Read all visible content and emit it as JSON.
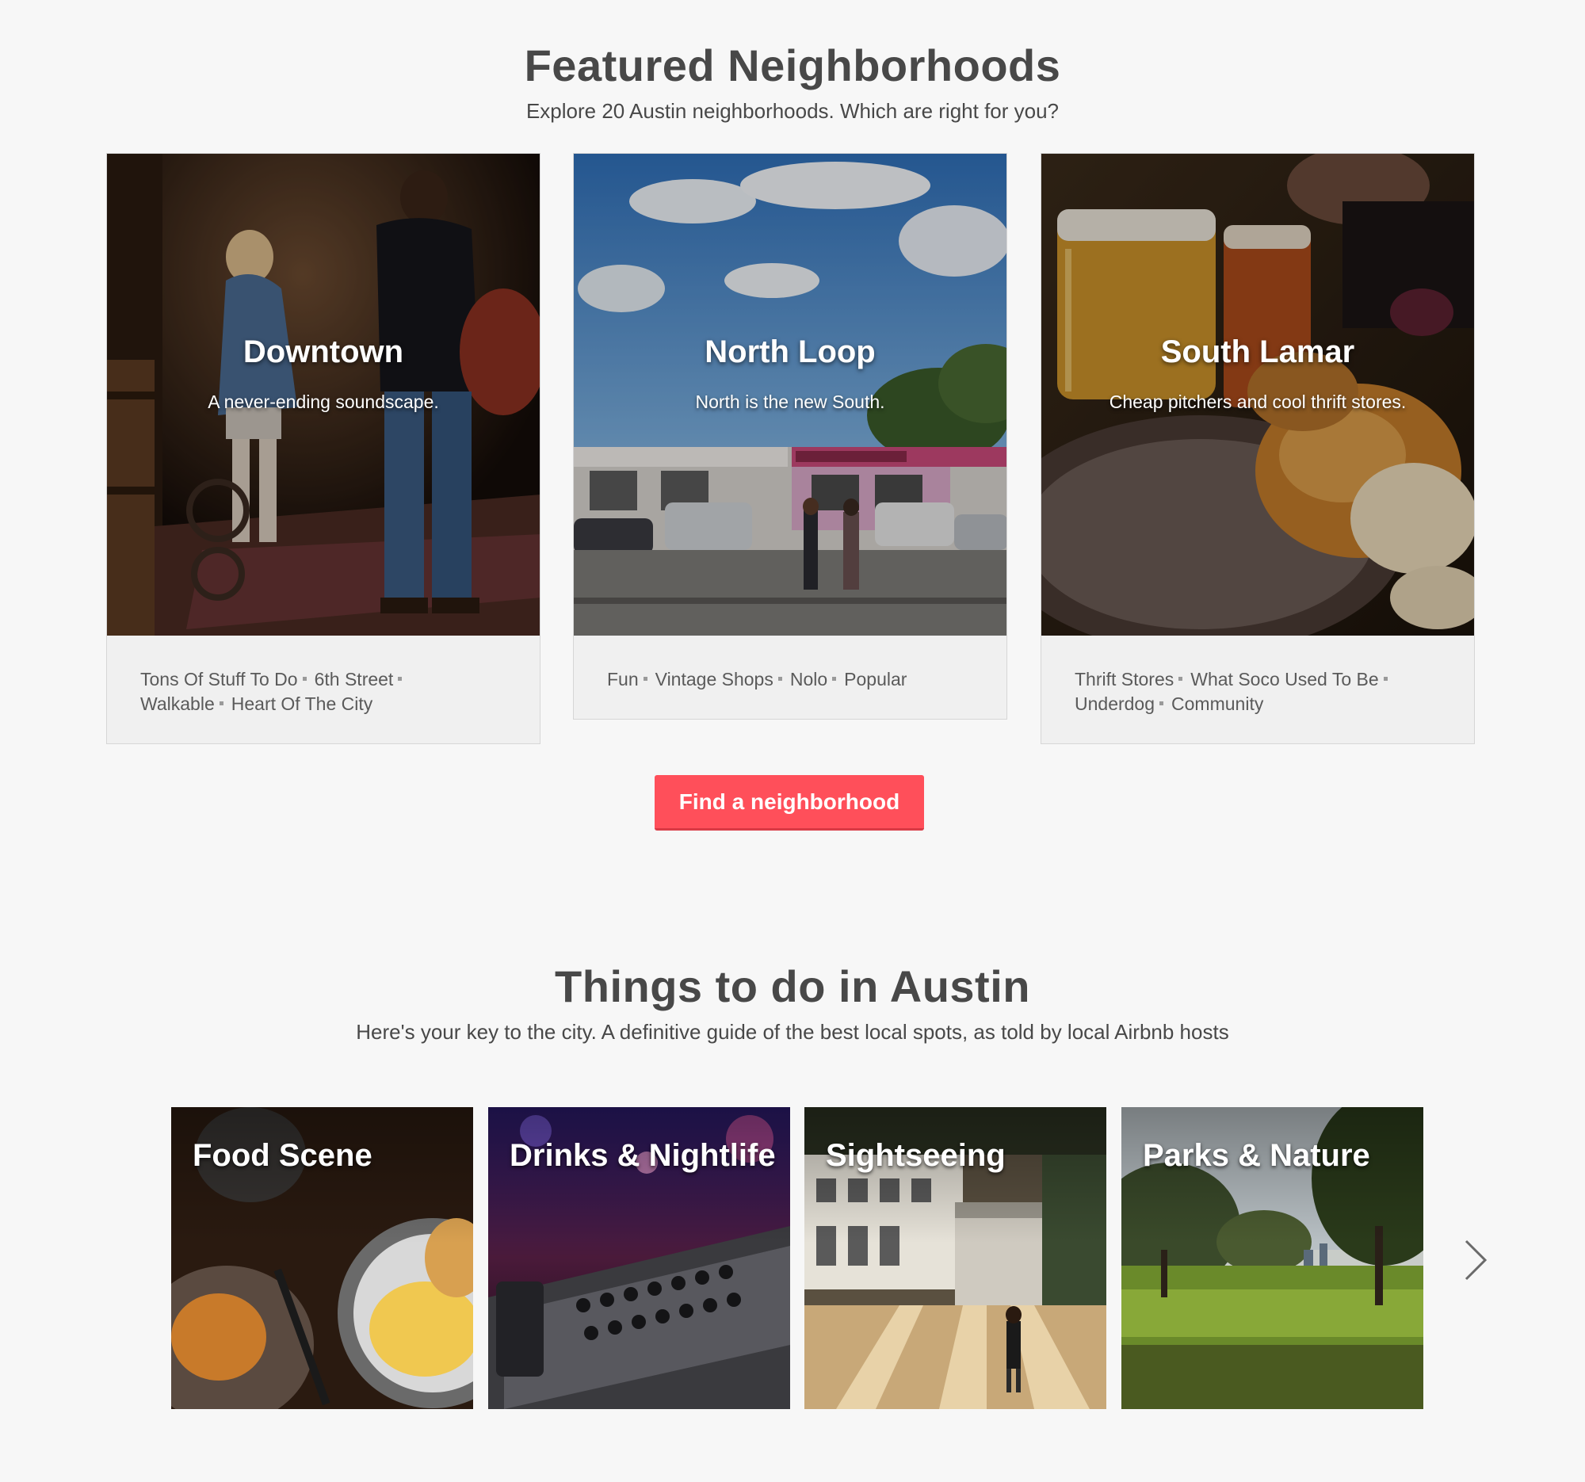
{
  "neighborhoods": {
    "title": "Featured Neighborhoods",
    "subtitle": "Explore 20 Austin neighborhoods. Which are right for you?",
    "cards": [
      {
        "name": "Downtown",
        "tagline": "A never-ending soundscape.",
        "tags": [
          "Tons Of Stuff To Do",
          "6th Street",
          "Walkable",
          "Heart Of The City"
        ]
      },
      {
        "name": "North Loop",
        "tagline": "North is the new South.",
        "tags": [
          "Fun",
          "Vintage Shops",
          "Nolo",
          "Popular"
        ]
      },
      {
        "name": "South Lamar",
        "tagline": "Cheap pitchers and cool thrift stores.",
        "tags": [
          "Thrift Stores",
          "What Soco Used To Be",
          "Underdog",
          "Community"
        ]
      }
    ],
    "button_label": "Find a neighborhood"
  },
  "things_to_do": {
    "title": "Things to do in Austin",
    "subtitle": "Here's your key to the city. A definitive guide of the best local spots, as told by local Airbnb hosts",
    "tiles": [
      {
        "label": "Food Scene"
      },
      {
        "label": "Drinks & Nightlife"
      },
      {
        "label": "Sightseeing"
      },
      {
        "label": "Parks & Nature"
      }
    ],
    "next_icon": "chevron-right-icon"
  },
  "colors": {
    "background": "#f7f7f7",
    "accent": "#ff4f5a",
    "text": "#484848"
  }
}
